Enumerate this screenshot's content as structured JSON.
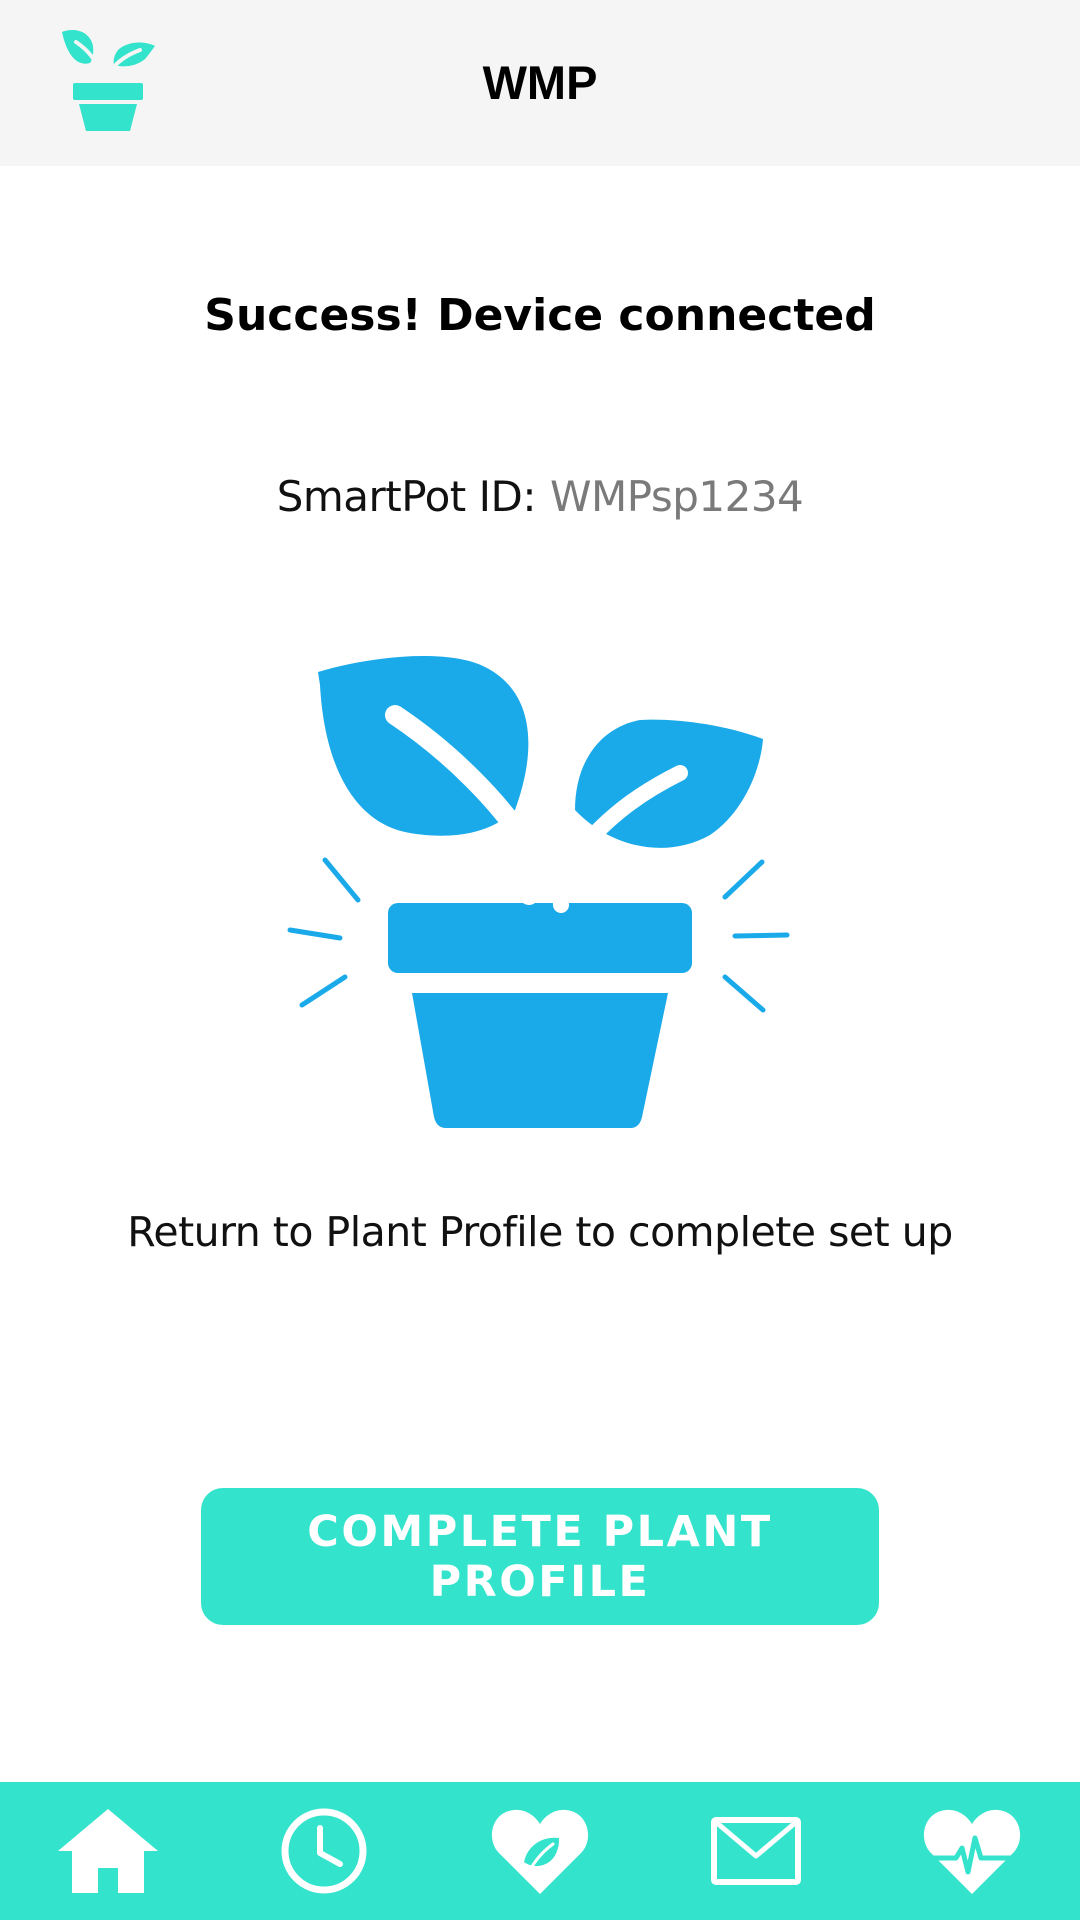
{
  "header": {
    "title": "WMP",
    "logo_icon": "plant-pot-icon"
  },
  "main": {
    "headline": "Success! Device connected",
    "smartpot_label": "SmartPot ID:",
    "smartpot_id": "WMPsp1234",
    "hero_icon": "plant-pot-icon",
    "message": "Return to Plant Profile to complete set up",
    "cta_label": "COMPLETE PLANT PROFILE"
  },
  "bottom_nav": [
    {
      "icon": "home-icon"
    },
    {
      "icon": "clock-icon"
    },
    {
      "icon": "heart-leaf-icon"
    },
    {
      "icon": "mail-icon"
    },
    {
      "icon": "heart-pulse-icon"
    }
  ],
  "colors": {
    "accent": "#33e3cb",
    "hero": "#1aa9e9",
    "header_bg": "#f5f5f5",
    "id_value": "#7a7a7a"
  }
}
